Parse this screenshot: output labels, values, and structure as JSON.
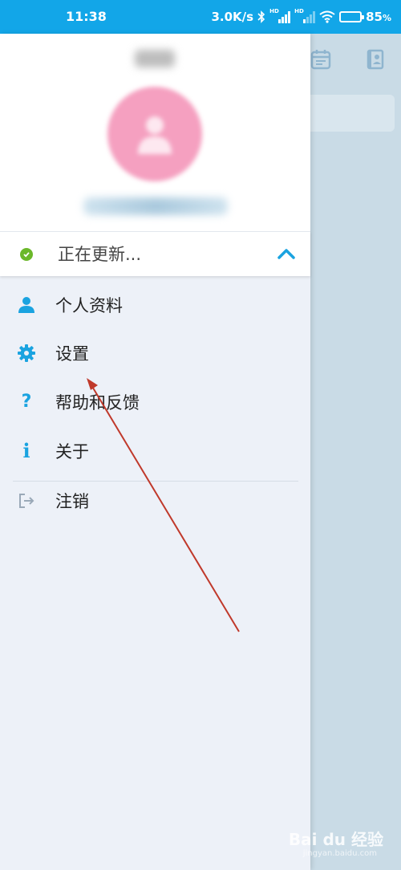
{
  "status_bar": {
    "time": "11:38",
    "speed": "3.0K/s",
    "battery": "85",
    "battery_unit": "%",
    "battery_level": 85,
    "hd_label": "HD"
  },
  "drawer": {
    "update_status": "正在更新...",
    "menu": [
      {
        "label": "个人资料",
        "icon": "person-icon"
      },
      {
        "label": "设置",
        "icon": "gear-icon"
      },
      {
        "label": "帮助和反馈",
        "icon": "help-icon"
      },
      {
        "label": "关于",
        "icon": "info-icon"
      },
      {
        "label": "注销",
        "icon": "logout-icon"
      }
    ]
  },
  "icons": {
    "help_glyph": "?",
    "info_glyph": "i"
  },
  "colors": {
    "status_bar": "#12a6e8",
    "accent": "#1aa3e0",
    "online": "#6bb82a",
    "arrow": "#c0392b"
  },
  "watermark": {
    "brand": "Bai du 经验",
    "sub": "jingyan.baidu.com"
  }
}
